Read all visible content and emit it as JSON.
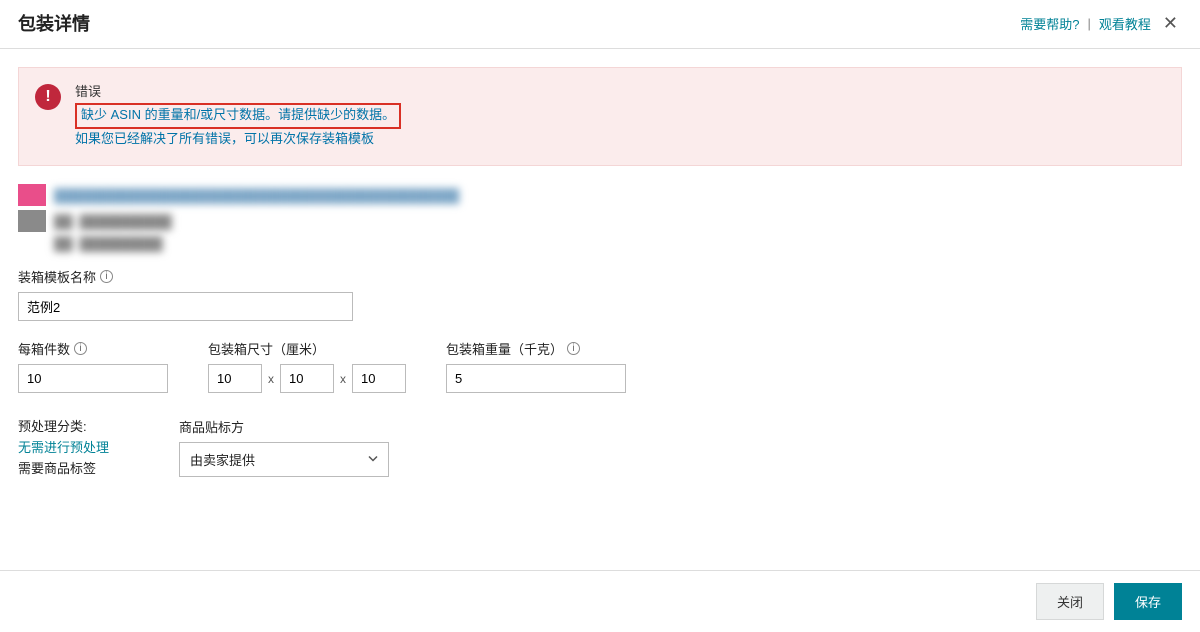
{
  "header": {
    "title": "包装详情",
    "help_link": "需要帮助?",
    "tutorial_link": "观看教程",
    "divider": "|"
  },
  "alert": {
    "title": "错误",
    "link_text": "缺少 ASIN 的重量和/或尺寸数据。请提供缺少的数据。",
    "resolved_text": "如果您已经解决了所有错误，可以再次保存装箱模板"
  },
  "product": {
    "line1_placeholder": "████████████████████████████████████████████",
    "line2_placeholder": "██: ██████████",
    "line3_placeholder": "██: █████████"
  },
  "template": {
    "name_label": "装箱模板名称",
    "name_value": "范例2"
  },
  "units": {
    "label": "每箱件数",
    "value": "10"
  },
  "dimensions": {
    "label": "包装箱尺寸（厘米）",
    "l": "10",
    "w": "10",
    "h": "10",
    "sep": "x"
  },
  "weight": {
    "label": "包装箱重量（千克）",
    "value": "5"
  },
  "prep": {
    "category_label": "预处理分类:",
    "category_value": "无需进行预处理",
    "label_needed": "需要商品标签"
  },
  "labeling": {
    "label": "商品贴标方",
    "selected": "由卖家提供"
  },
  "footer": {
    "close": "关闭",
    "save": "保存"
  }
}
